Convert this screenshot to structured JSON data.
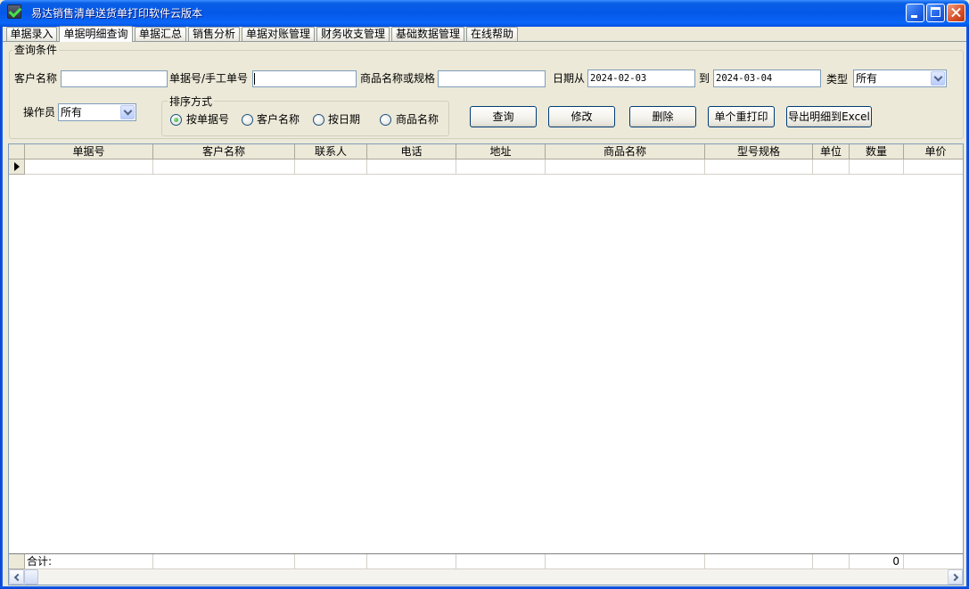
{
  "window": {
    "title": "易达销售清单送货单打印软件云版本"
  },
  "icons": {
    "app": "checkmark-app-icon",
    "minimize": "minimize-icon",
    "maximize": "maximize-icon",
    "close": "close-icon",
    "dropdown": "chevron-down-icon",
    "row_indicator": "row-pointer-icon",
    "scroll_left": "chevron-left-icon",
    "scroll_right": "chevron-right-icon"
  },
  "colors": {
    "titlebar": "#0A5FE6",
    "face": "#ECE9D8",
    "input_border": "#7F9DB9",
    "button_border": "#003C74",
    "radio_selected": "#21A121",
    "close_button": "#D9532C",
    "grid_line": "#ACA899"
  },
  "tabs": [
    {
      "label": "单据录入"
    },
    {
      "label": "单据明细查询",
      "active": true
    },
    {
      "label": "单据汇总"
    },
    {
      "label": "销售分析"
    },
    {
      "label": "单据对账管理"
    },
    {
      "label": "财务收支管理"
    },
    {
      "label": "基础数据管理"
    },
    {
      "label": "在线帮助"
    }
  ],
  "query": {
    "group_label": "查询条件",
    "customer": {
      "label": "客户名称",
      "value": ""
    },
    "order_no": {
      "label": "单据号/手工单号",
      "value": ""
    },
    "product": {
      "label": "商品名称或规格",
      "value": ""
    },
    "date_from": {
      "label": "日期从",
      "value": "2024-02-03"
    },
    "date_to": {
      "label": "到",
      "value": "2024-03-04"
    },
    "type": {
      "label": "类型",
      "selected": "所有"
    },
    "operator": {
      "label": "操作员",
      "selected": "所有"
    }
  },
  "sort": {
    "label": "排序方式",
    "options": [
      {
        "label": "按单据号",
        "selected": true
      },
      {
        "label": "客户名称",
        "selected": false
      },
      {
        "label": "按日期",
        "selected": false
      },
      {
        "label": "商品名称",
        "selected": false
      }
    ]
  },
  "actions": {
    "query": "查询",
    "edit": "修改",
    "delete": "删除",
    "reprint": "单个重打印",
    "export": "导出明细到Excel"
  },
  "grid": {
    "columns": [
      "单据号",
      "客户名称",
      "联系人",
      "电话",
      "地址",
      "商品名称",
      "型号规格",
      "单位",
      "数量",
      "单价"
    ],
    "rows": [
      [
        "",
        "",
        "",
        "",
        "",
        "",
        "",
        "",
        "",
        ""
      ]
    ],
    "current_row": 0,
    "footer": {
      "label": "合计:",
      "quantity": "0"
    },
    "horizontal_scroll": 0
  }
}
